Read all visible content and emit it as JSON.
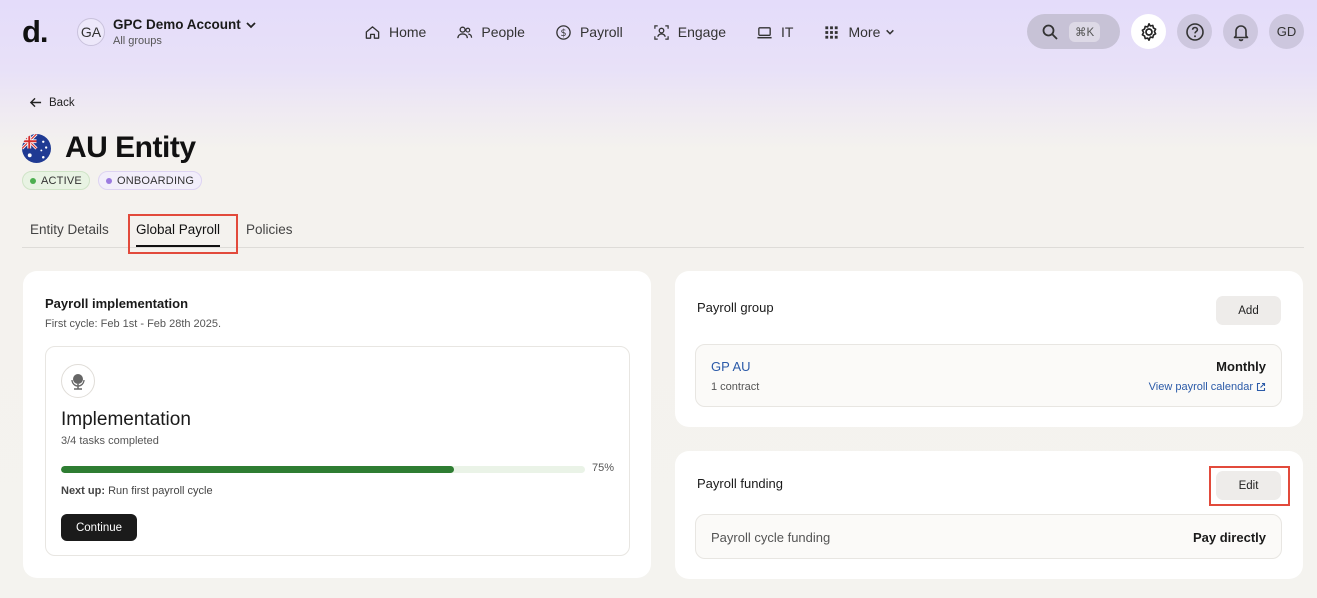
{
  "nav": {
    "logo": "d.",
    "account": {
      "initials": "GA",
      "name": "GPC Demo Account",
      "subtitle": "All groups"
    },
    "items": [
      {
        "label": "Home",
        "icon": "home-icon"
      },
      {
        "label": "People",
        "icon": "people-icon"
      },
      {
        "label": "Payroll",
        "icon": "dollar-circle-icon"
      },
      {
        "label": "Engage",
        "icon": "engage-icon"
      },
      {
        "label": "IT",
        "icon": "laptop-icon"
      },
      {
        "label": "More",
        "icon": "grid-icon"
      }
    ],
    "search_shortcut": "⌘K",
    "user_initials": "GD"
  },
  "page": {
    "back_label": "Back",
    "title": "AU Entity",
    "badges": [
      {
        "label": "ACTIVE",
        "color": "#4caf50"
      },
      {
        "label": "ONBOARDING",
        "color": "#9c7be0"
      }
    ],
    "tabs": [
      {
        "label": "Entity Details",
        "selected": false
      },
      {
        "label": "Global Payroll",
        "selected": true
      },
      {
        "label": "Policies",
        "selected": false
      }
    ]
  },
  "implementation_card": {
    "title": "Payroll implementation",
    "first_cycle": "First cycle: Feb 1st - Feb 28th 2025.",
    "heading": "Implementation",
    "tasks": "3/4 tasks completed",
    "progress": 0.75,
    "progress_label": "75%",
    "next_up_label": "Next up:",
    "next_up_value": "Run first payroll cycle",
    "continue_label": "Continue"
  },
  "payroll_group_card": {
    "title": "Payroll group",
    "add_label": "Add",
    "group_name": "GP AU",
    "group_contracts": "1 contract",
    "frequency": "Monthly",
    "calendar_link": "View payroll calendar"
  },
  "payroll_funding_card": {
    "title": "Payroll funding",
    "edit_label": "Edit",
    "row_label": "Payroll cycle funding",
    "row_value": "Pay directly"
  },
  "colors": {
    "accent_link": "#2b5aa8",
    "progress_fill": "#2e7d32",
    "highlight_box": "#e24a3b"
  }
}
